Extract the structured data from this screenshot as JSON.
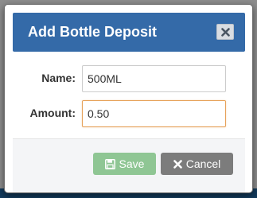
{
  "modal": {
    "title": "Add Bottle Deposit",
    "close_icon": "close-icon"
  },
  "form": {
    "name": {
      "label": "Name:",
      "value": "500ML"
    },
    "amount": {
      "label": "Amount:",
      "value": "0.50"
    }
  },
  "footer": {
    "save_label": "Save",
    "save_icon": "floppy-disk-icon",
    "cancel_label": "Cancel",
    "cancel_icon": "times-icon"
  },
  "colors": {
    "header": "#346aa8",
    "save_button": "#8fc694",
    "cancel_button": "#7c7c7c",
    "focus_border": "#e6a25a"
  }
}
